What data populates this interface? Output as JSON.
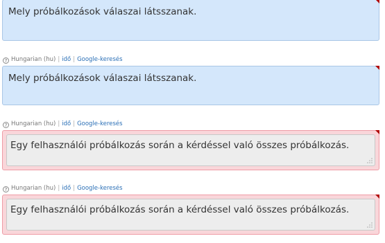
{
  "entries": [
    {
      "style": "blue",
      "text": "Mely próbálkozások válaszai látsszanak."
    },
    {
      "meta": {
        "help_symbol": "?",
        "language": "Hungarian (hu)",
        "separator": "|",
        "link_time": "idő",
        "link_search": "Google-keresés"
      },
      "style": "blue",
      "text": "Mely próbálkozások válaszai látsszanak."
    },
    {
      "meta": {
        "help_symbol": "?",
        "language": "Hungarian (hu)",
        "separator": "|",
        "link_time": "idő",
        "link_search": "Google-keresés"
      },
      "style": "red",
      "text": "Egy felhasználói próbálkozás során a kérdéssel való összes próbálkozás."
    },
    {
      "meta": {
        "help_symbol": "?",
        "language": "Hungarian (hu)",
        "separator": "|",
        "link_time": "idő",
        "link_search": "Google-keresés"
      },
      "style": "red",
      "text": "Egy felhasználói próbálkozás során a kérdéssel való összes próbálkozás."
    }
  ],
  "colors": {
    "blue_fill": "#d4e7fb",
    "red_fill": "#f9d6da",
    "corner_marker": "#b00000",
    "link": "#2a6fb6"
  }
}
